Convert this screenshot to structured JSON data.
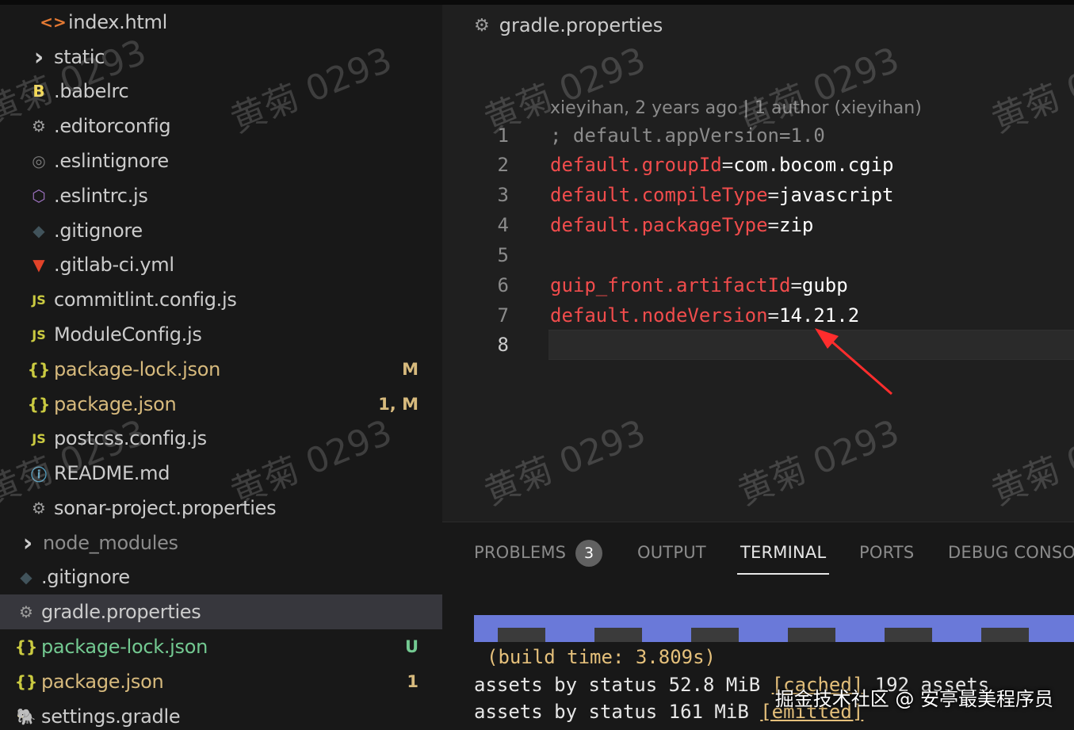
{
  "explorer": {
    "items": [
      {
        "icon": "html-icon",
        "glyph": "<>",
        "label": "index.html",
        "color": "#e37933",
        "badge": "",
        "name_style": ""
      },
      {
        "icon": "chevron-right-icon",
        "glyph": "›",
        "label": "static",
        "color": "#cccccc",
        "badge": "",
        "name_style": ""
      },
      {
        "icon": "babel-icon",
        "glyph": "B",
        "label": ".babelrc",
        "color": "#f5da55",
        "badge": "",
        "name_style": ""
      },
      {
        "icon": "gear-icon",
        "glyph": "⚙",
        "label": ".editorconfig",
        "color": "#9d9d9d",
        "badge": "",
        "name_style": ""
      },
      {
        "icon": "eslint-ignore-icon",
        "glyph": "◎",
        "label": ".eslintignore",
        "color": "#7a7a7a",
        "badge": "",
        "name_style": ""
      },
      {
        "icon": "eslint-icon",
        "glyph": "⬡",
        "label": ".eslintrc.js",
        "color": "#a074c4",
        "badge": "",
        "name_style": ""
      },
      {
        "icon": "git-icon",
        "glyph": "◆",
        "label": ".gitignore",
        "color": "#41535b",
        "badge": "",
        "name_style": ""
      },
      {
        "icon": "gitlab-icon",
        "glyph": "▼",
        "label": ".gitlab-ci.yml",
        "color": "#e24329",
        "badge": "",
        "name_style": ""
      },
      {
        "icon": "js-icon",
        "glyph": "JS",
        "label": "commitlint.config.js",
        "color": "#cbcb41",
        "badge": "",
        "name_style": ""
      },
      {
        "icon": "js-icon",
        "glyph": "JS",
        "label": "ModuleConfig.js",
        "color": "#cbcb41",
        "badge": "",
        "name_style": ""
      },
      {
        "icon": "json-icon",
        "glyph": "{}",
        "label": "package-lock.json",
        "color": "#cbcb41",
        "badge": "M",
        "name_style": "mod"
      },
      {
        "icon": "json-icon",
        "glyph": "{}",
        "label": "package.json",
        "color": "#cbcb41",
        "badge": "1, M",
        "name_style": "mod"
      },
      {
        "icon": "js-icon",
        "glyph": "JS",
        "label": "postcss.config.js",
        "color": "#cbcb41",
        "badge": "",
        "name_style": ""
      },
      {
        "icon": "info-icon",
        "glyph": "ⓘ",
        "label": "README.md",
        "color": "#519aba",
        "badge": "",
        "name_style": ""
      },
      {
        "icon": "gear-icon",
        "glyph": "⚙",
        "label": "sonar-project.properties",
        "color": "#9d9d9d",
        "badge": "",
        "name_style": ""
      },
      {
        "icon": "chevron-right-icon",
        "glyph": "›",
        "label": "node_modules",
        "color": "#cccccc",
        "badge": "",
        "name_style": "dim"
      },
      {
        "icon": "git-icon",
        "glyph": "◆",
        "label": ".gitignore",
        "color": "#41535b",
        "badge": "",
        "name_style": ""
      },
      {
        "icon": "gear-icon",
        "glyph": "⚙",
        "label": "gradle.properties",
        "color": "#9d9d9d",
        "badge": "",
        "name_style": ""
      },
      {
        "icon": "json-icon",
        "glyph": "{}",
        "label": "package-lock.json",
        "color": "#cbcb41",
        "badge": "U",
        "name_style": "untracked"
      },
      {
        "icon": "json-icon",
        "glyph": "{}",
        "label": "package.json",
        "color": "#cbcb41",
        "badge": "1",
        "name_style": "mod"
      },
      {
        "icon": "gradle-icon",
        "glyph": "🐘",
        "label": "settings.gradle",
        "color": "#5aa0c8",
        "badge": "",
        "name_style": ""
      }
    ],
    "badge_colors": {
      "M": "#d7ba7d",
      "1, M": "#d7ba7d",
      "U": "#73c991",
      "1": "#d7ba7d"
    }
  },
  "editor": {
    "filename": "gradle.properties",
    "blame": "xieyihan, 2 years ago | 1 author (xieyihan)",
    "lines": [
      {
        "n": "1",
        "key": "; default.appVersion=1.0",
        "eq": "",
        "val": "",
        "comment": true
      },
      {
        "n": "2",
        "key": "default.groupId",
        "eq": "=",
        "val": "com.bocom.cgip",
        "comment": false
      },
      {
        "n": "3",
        "key": "default.compileType",
        "eq": "=",
        "val": "javascript",
        "comment": false
      },
      {
        "n": "4",
        "key": "default.packageType",
        "eq": "=",
        "val": "zip",
        "comment": false
      },
      {
        "n": "5",
        "key": "",
        "eq": "",
        "val": "",
        "comment": false
      },
      {
        "n": "6",
        "key": "guip_front.artifactId",
        "eq": "=",
        "val": "gubp",
        "comment": false
      },
      {
        "n": "7",
        "key": "default.nodeVersion",
        "eq": "=",
        "val": "14.21.2",
        "comment": false
      },
      {
        "n": "8",
        "key": "",
        "eq": "",
        "val": "",
        "comment": false
      }
    ]
  },
  "panel": {
    "tabs": {
      "problems": "PROBLEMS",
      "problems_count": "3",
      "output": "OUTPUT",
      "terminal": "TERMINAL",
      "ports": "PORTS",
      "debug": "DEBUG CONSOL"
    },
    "terminal": {
      "build": "(build time: 3.809s)",
      "line1_prefix": "assets by status 52.8 MiB ",
      "line1_tag": "[cached]",
      "line1_suffix": " 192 assets",
      "line2_prefix": "assets by status 161 MiB ",
      "line2_tag": "[emitted]"
    }
  },
  "watermark": "黄菊 0293",
  "credit": "掘金技术社区 @ 安亭最美程序员",
  "colors": {
    "accent_arrow": "#ff2d2d",
    "key": "#f14c4c",
    "progress": "#6a79d9"
  }
}
